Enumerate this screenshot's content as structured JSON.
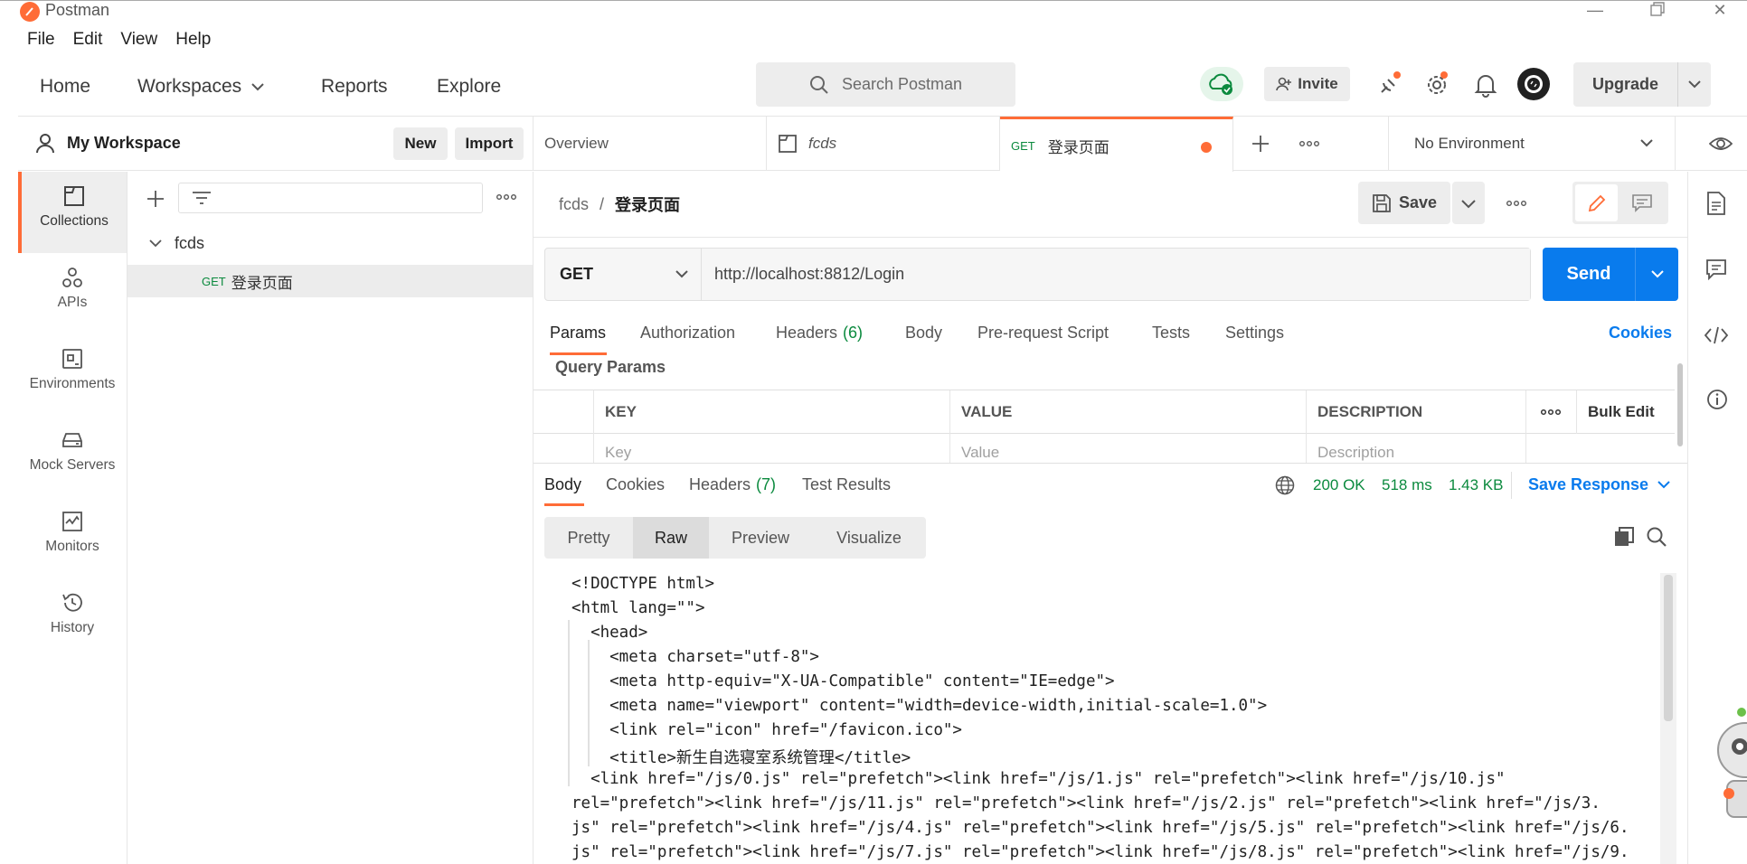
{
  "window": {
    "title": "Postman"
  },
  "menu": [
    "File",
    "Edit",
    "View",
    "Help"
  ],
  "header": {
    "nav": {
      "home": "Home",
      "workspaces": "Workspaces",
      "reports": "Reports",
      "explore": "Explore"
    },
    "search_placeholder": "Search Postman",
    "invite": "Invite",
    "upgrade": "Upgrade"
  },
  "workspace": {
    "name": "My Workspace",
    "new": "New",
    "import": "Import"
  },
  "sidebar": {
    "items": [
      {
        "label": "Collections",
        "icon": "collections-icon"
      },
      {
        "label": "APIs",
        "icon": "apis-icon"
      },
      {
        "label": "Environments",
        "icon": "environments-icon"
      },
      {
        "label": "Mock Servers",
        "icon": "mock-servers-icon"
      },
      {
        "label": "Monitors",
        "icon": "monitors-icon"
      },
      {
        "label": "History",
        "icon": "history-icon"
      }
    ]
  },
  "collections": {
    "tree": {
      "collection": "fcds",
      "request_method": "GET",
      "request_name": "登录页面"
    }
  },
  "tabs": {
    "overview": "Overview",
    "collection": "fcds",
    "active_method": "GET",
    "active_name": "登录页面",
    "environment": "No Environment"
  },
  "request": {
    "breadcrumb_parent": "fcds",
    "breadcrumb_sep": "/",
    "breadcrumb_current": "登录页面",
    "save": "Save",
    "method": "GET",
    "url": "http://localhost:8812/Login",
    "send": "Send",
    "tabs": {
      "params": "Params",
      "authorization": "Authorization",
      "headers": "Headers",
      "headers_count": "(6)",
      "body": "Body",
      "prerequest": "Pre-request Script",
      "tests": "Tests",
      "settings": "Settings"
    },
    "cookies": "Cookies",
    "query_params_title": "Query Params",
    "table": {
      "key": "KEY",
      "value": "VALUE",
      "description": "DESCRIPTION",
      "bulk_edit": "Bulk Edit",
      "key_placeholder": "Key",
      "value_placeholder": "Value",
      "description_placeholder": "Description"
    }
  },
  "response": {
    "tabs": {
      "body": "Body",
      "cookies": "Cookies",
      "headers": "Headers",
      "headers_count": "(7)",
      "test_results": "Test Results"
    },
    "status": "200 OK",
    "time": "518 ms",
    "size": "1.43 KB",
    "save_response": "Save Response",
    "view_modes": [
      "Pretty",
      "Raw",
      "Preview",
      "Visualize"
    ],
    "active_view": "Raw",
    "body_lines": [
      "<!DOCTYPE html>",
      "<html lang=\"\">",
      "  <head>",
      "    <meta charset=\"utf-8\">",
      "    <meta http-equiv=\"X-UA-Compatible\" content=\"IE=edge\">",
      "    <meta name=\"viewport\" content=\"width=device-width,initial-scale=1.0\">",
      "    <link rel=\"icon\" href=\"/favicon.ico\">",
      "    <title>新生自选寝室系统管理</title>",
      "  <link href=\"/js/0.js\" rel=\"prefetch\"><link href=\"/js/1.js\" rel=\"prefetch\"><link href=\"/js/10.js\"",
      "rel=\"prefetch\"><link href=\"/js/11.js\" rel=\"prefetch\"><link href=\"/js/2.js\" rel=\"prefetch\"><link href=\"/js/3.",
      "js\" rel=\"prefetch\"><link href=\"/js/4.js\" rel=\"prefetch\"><link href=\"/js/5.js\" rel=\"prefetch\"><link href=\"/js/6.",
      "js\" rel=\"prefetch\"><link href=\"/js/7.js\" rel=\"prefetch\"><link href=\"/js/8.js\" rel=\"prefetch\"><link href=\"/js/9."
    ]
  },
  "colors": {
    "accent": "#ff6c37",
    "primary": "#097bed",
    "success": "#0b8a3e"
  }
}
